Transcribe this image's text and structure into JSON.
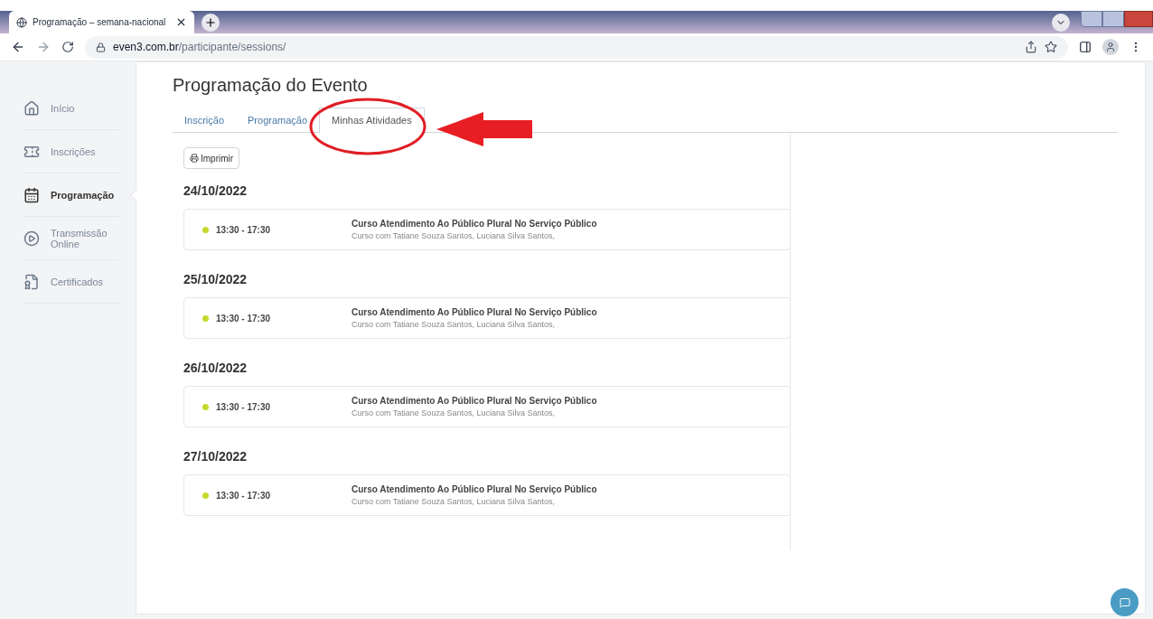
{
  "browser": {
    "tab_title": "Programação – semana-nacional",
    "url_host": "even3.com.br",
    "url_path": "/participante/sessions/"
  },
  "sidebar": {
    "items": [
      {
        "label": "Início",
        "selected": false
      },
      {
        "label": "Inscrições",
        "selected": false
      },
      {
        "label": "Programação",
        "selected": true
      },
      {
        "label": "Transmissão Online",
        "selected": false
      },
      {
        "label": "Certificados",
        "selected": false
      }
    ]
  },
  "page": {
    "title": "Programação do Evento",
    "tabs": [
      {
        "label": "Inscrição",
        "selected": false
      },
      {
        "label": "Programação",
        "selected": false
      },
      {
        "label": "Minhas Atividades",
        "selected": true
      }
    ],
    "print_button": "Imprimir",
    "days": [
      {
        "date": "24/10/2022",
        "sessions": [
          {
            "time": "13:30 - 17:30",
            "color": "#c5d92d",
            "title": "Curso Atendimento Ao Público Plural No Serviço Público",
            "subtitle": "Curso com Tatiane Souza Santos, Luciana Silva Santos,"
          }
        ]
      },
      {
        "date": "25/10/2022",
        "sessions": [
          {
            "time": "13:30 - 17:30",
            "color": "#c5d92d",
            "title": "Curso Atendimento Ao Público Plural No Serviço Público",
            "subtitle": "Curso com Tatiane Souza Santos, Luciana Silva Santos,"
          }
        ]
      },
      {
        "date": "26/10/2022",
        "sessions": [
          {
            "time": "13:30 - 17:30",
            "color": "#c5d92d",
            "title": "Curso Atendimento Ao Público Plural No Serviço Público",
            "subtitle": "Curso com Tatiane Souza Santos, Luciana Silva Santos,"
          }
        ]
      },
      {
        "date": "27/10/2022",
        "sessions": [
          {
            "time": "13:30 - 17:30",
            "color": "#c5d92d",
            "title": "Curso Atendimento Ao Público Plural No Serviço Público",
            "subtitle": "Curso com Tatiane Souza Santos, Luciana Silva Santos,"
          }
        ]
      }
    ]
  }
}
